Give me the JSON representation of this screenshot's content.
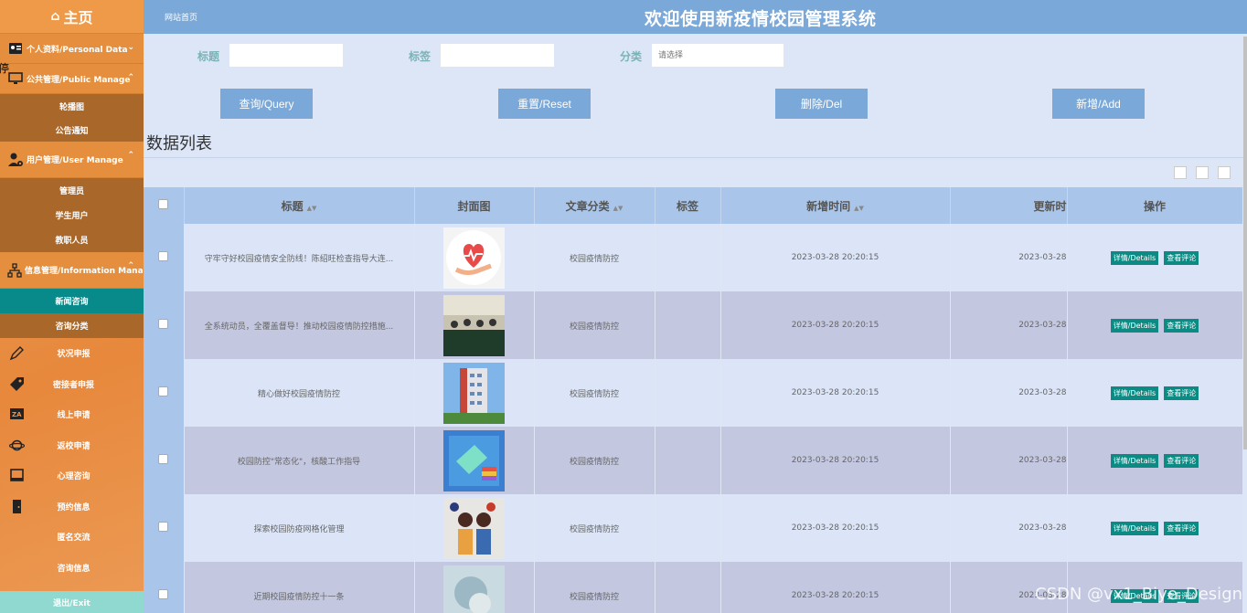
{
  "sidebar": {
    "home": "主页",
    "stray_text": "停",
    "groups": [
      {
        "label": "个人资料/Personal Data",
        "icon": "person-card-icon",
        "expanded": false
      },
      {
        "label": "公共管理/Public Manage",
        "icon": "monitor-icon",
        "expanded": true,
        "items": [
          "轮播图",
          "公告通知"
        ]
      },
      {
        "label": "用户管理/User Manage",
        "icon": "user-gear-icon",
        "expanded": true,
        "items": [
          "管理员",
          "学生用户",
          "教职人员"
        ]
      },
      {
        "label": "信息管理/Information Manage",
        "icon": "sitemap-icon",
        "expanded": true,
        "items": [
          "新闻咨询",
          "咨询分类"
        ],
        "active": "新闻咨询"
      }
    ],
    "plain_items": [
      {
        "label": "状况申报",
        "icon": "pencil-ruler-icon"
      },
      {
        "label": "密接者申报",
        "icon": "tag-icon"
      },
      {
        "label": "线上申请",
        "icon": "translate-icon"
      },
      {
        "label": "返校申请",
        "icon": "planet-icon"
      },
      {
        "label": "心理咨询",
        "icon": "book-icon"
      },
      {
        "label": "预约信息",
        "icon": "door-icon"
      },
      {
        "label": "匿名交流",
        "icon": ""
      },
      {
        "label": "咨询信息",
        "icon": ""
      }
    ],
    "exit": "退出/Exit"
  },
  "topbar": {
    "breadcrumb": "网站首页",
    "title": "欢迎使用新疫情校园管理系统"
  },
  "search": {
    "title_label": "标题",
    "tag_label": "标签",
    "category_label": "分类",
    "title_value": "",
    "tag_value": "",
    "category_placeholder": "请选择",
    "buttons": {
      "query": "查询/Query",
      "reset": "重置/Reset",
      "delete": "删除/Del",
      "add": "新增/Add"
    }
  },
  "list_title": "数据列表",
  "table": {
    "columns": [
      "标题",
      "封面图",
      "文章分类",
      "标签",
      "新增时间",
      "更新时",
      "操作"
    ],
    "rows": [
      {
        "title": "守牢守好校园疫情安全防线！陈绍旺检查指导大连...",
        "category": "校园疫情防控",
        "tag": "",
        "created": "2023-03-28 20:20:15",
        "updated": "2023-03-28",
        "cover": "heart-hand"
      },
      {
        "title": "全系统动员，全覆盖督导！推动校园疫情防控措施...",
        "category": "校园疫情防控",
        "tag": "",
        "created": "2023-03-28 20:20:15",
        "updated": "2023-03-28",
        "cover": "meeting"
      },
      {
        "title": "精心做好校园疫情防控",
        "category": "校园疫情防控",
        "tag": "",
        "created": "2023-03-28 20:20:15",
        "updated": "2023-03-28",
        "cover": "building"
      },
      {
        "title": "校园防控\"常态化\"，核酸工作指导",
        "category": "校园疫情防控",
        "tag": "",
        "created": "2023-03-28 20:20:15",
        "updated": "2023-03-28",
        "cover": "books"
      },
      {
        "title": "探索校园防疫网格化管理",
        "category": "校园疫情防控",
        "tag": "",
        "created": "2023-03-28 20:20:15",
        "updated": "2023-03-28",
        "cover": "students"
      },
      {
        "title": "近期校园疫情防控十一条",
        "category": "校园疫情防控",
        "tag": "",
        "created": "2023-03-28 20:20:15",
        "updated": "2023-03-28",
        "cover": "blur"
      }
    ],
    "op_details": "详情/Details",
    "op_comments": "查看评论"
  },
  "watermark": "CSDN @vx1_Biye_Design"
}
